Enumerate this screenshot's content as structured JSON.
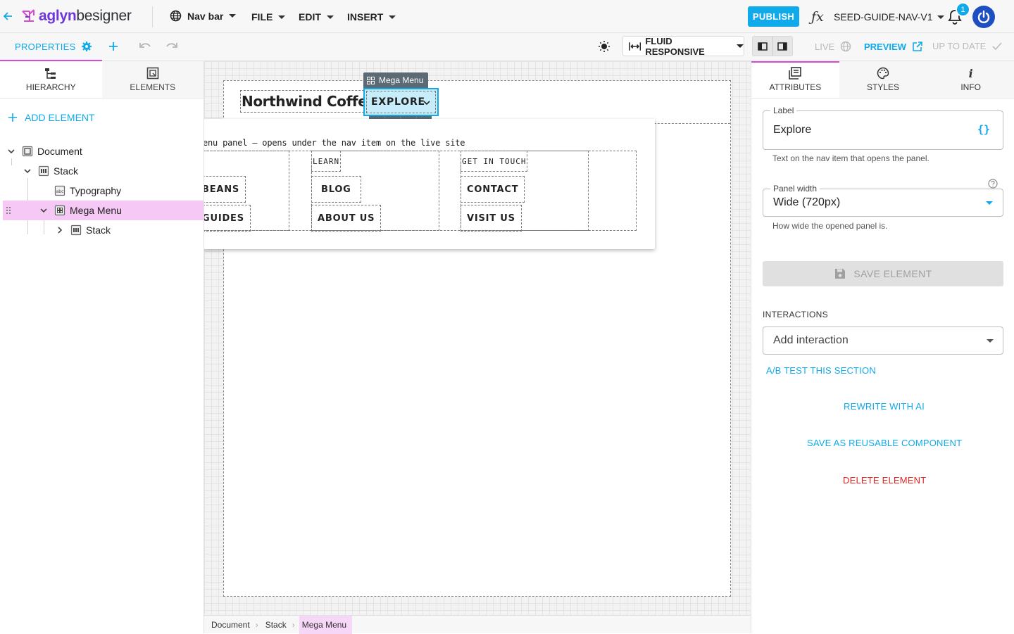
{
  "app": {
    "logo_bold": "aglyn",
    "logo_rest": "besigner",
    "nav_selector": "Nav bar",
    "menus": [
      "FILE",
      "EDIT",
      "INSERT"
    ],
    "publish": "PUBLISH",
    "project_name": "SEED-GUIDE-NAV-V1",
    "notification_count": "1",
    "accent": "#10aaea",
    "highlight": "#d64bd1"
  },
  "toolbar": {
    "properties": "PROPERTIES",
    "responsive_mode": "FLUID RESPONSIVE",
    "live": "LIVE",
    "preview": "PREVIEW",
    "up_to_date": "UP TO DATE"
  },
  "left": {
    "tabs": [
      "HIERARCHY",
      "ELEMENTS"
    ],
    "add_element": "ADD ELEMENT",
    "tree": [
      {
        "label": "Document"
      },
      {
        "label": "Stack"
      },
      {
        "label": "Typography"
      },
      {
        "label": "Mega Menu"
      },
      {
        "label": "Stack"
      }
    ]
  },
  "canvas": {
    "brand": "Northwind Coffee",
    "element_label": "Mega Menu",
    "nav_item": "EXPLORE",
    "panel_note": "enu panel — opens under the nav item on the live site",
    "col1_items": [
      "BEANS",
      "GUIDES"
    ],
    "col2_head": "LEARN",
    "col2_items": [
      "BLOG",
      "ABOUT US"
    ],
    "col3_head": "GET IN TOUCH",
    "col3_items": [
      "CONTACT",
      "VISIT US"
    ]
  },
  "breadcrumbs": [
    "Document",
    "Stack",
    "Mega Menu"
  ],
  "right": {
    "tabs": [
      "ATTRIBUTES",
      "STYLES",
      "INFO"
    ],
    "label_legend": "Label",
    "label_value": "Explore",
    "label_helper": "Text on the nav item that opens the panel.",
    "width_legend": "Panel width",
    "width_value": "Wide (720px)",
    "width_helper": "How wide the opened panel is.",
    "save": "SAVE ELEMENT",
    "interactions_title": "INTERACTIONS",
    "interaction_placeholder": "Add interaction",
    "ab_test": "A/B TEST THIS SECTION",
    "rewrite": "REWRITE WITH AI",
    "save_reusable": "SAVE AS REUSABLE COMPONENT",
    "delete": "DELETE ELEMENT"
  }
}
